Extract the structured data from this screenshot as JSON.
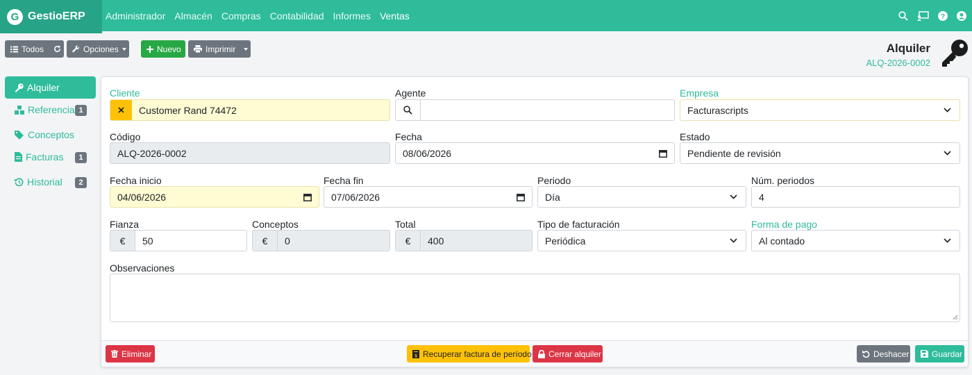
{
  "app": {
    "logo_letter": "G",
    "name": "GestioERP"
  },
  "nav": {
    "items": [
      "Administrador",
      "Almacén",
      "Compras",
      "Contabilidad",
      "Informes",
      "Ventas"
    ],
    "active": "Ventas",
    "icons": [
      "search-icon",
      "presentation-icon",
      "help-icon",
      "user-icon"
    ]
  },
  "toolbar": {
    "todos": "Todos",
    "opciones": "Opciones",
    "nuevo": "Nuevo",
    "imprimir": "Imprimir"
  },
  "doc": {
    "title": "Alquiler",
    "code": "ALQ-2026-0002"
  },
  "sidebar": {
    "items": [
      {
        "label": "Alquiler",
        "icon": "key-icon",
        "badge": ""
      },
      {
        "label": "Referencias",
        "icon": "boxes-icon",
        "badge": "1"
      },
      {
        "label": "Conceptos",
        "icon": "tags-icon",
        "badge": ""
      },
      {
        "label": "Facturas",
        "icon": "invoice-icon",
        "badge": "1"
      },
      {
        "label": "Historial",
        "icon": "history-icon",
        "badge": "2"
      }
    ]
  },
  "form": {
    "cliente": {
      "label": "Cliente",
      "value": "Customer Rand 74472"
    },
    "agente": {
      "label": "Agente",
      "value": ""
    },
    "empresa": {
      "label": "Empresa",
      "value": "Facturascripts"
    },
    "codigo": {
      "label": "Código",
      "value": "ALQ-2026-0002"
    },
    "fecha": {
      "label": "Fecha",
      "value": "08/06/2026"
    },
    "estado": {
      "label": "Estado",
      "value": "Pendiente de revisión"
    },
    "fecha_inicio": {
      "label": "Fecha inicio",
      "value": "04/06/2026"
    },
    "fecha_fin": {
      "label": "Fecha fin",
      "value": "07/06/2026"
    },
    "periodo": {
      "label": "Periodo",
      "value": "Día"
    },
    "num_periodos": {
      "label": "Núm. periodos",
      "value": "4"
    },
    "fianza": {
      "label": "Fianza",
      "currency": "€",
      "value": "50"
    },
    "conceptos": {
      "label": "Conceptos",
      "currency": "€",
      "value": "0"
    },
    "total": {
      "label": "Total",
      "currency": "€",
      "value": "400"
    },
    "tipo_facturacion": {
      "label": "Tipo de facturación",
      "value": "Periódica"
    },
    "forma_pago": {
      "label": "Forma de pago",
      "value": "Al contado"
    },
    "observaciones": {
      "label": "Observaciones",
      "value": ""
    }
  },
  "footer": {
    "eliminar": "Eliminar",
    "recuperar": "Recuperar factura de período",
    "cerrar": "Cerrar alquiler",
    "deshacer": "Deshacer",
    "guardar": "Guardar"
  },
  "colors": {
    "primary": "#2ebc9b",
    "danger": "#dc3545",
    "warning": "#ffc107",
    "secondary": "#6c757d",
    "success": "#28a745"
  }
}
